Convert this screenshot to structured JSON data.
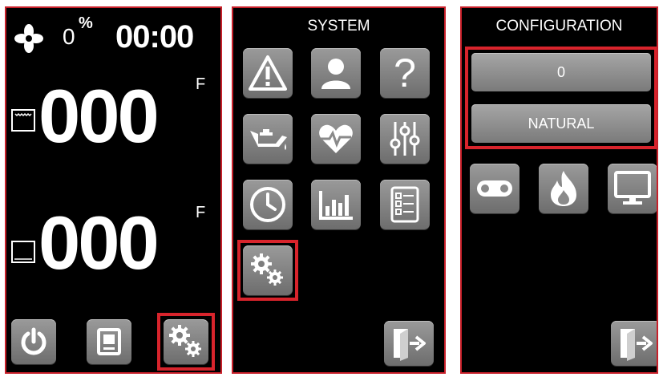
{
  "home": {
    "humidity_value": "0",
    "humidity_unit": "%",
    "timer": "00:00",
    "top_temp": "000",
    "top_unit": "F",
    "bottom_temp": "000",
    "bottom_unit": "F"
  },
  "system": {
    "title": "SYSTEM",
    "icons": [
      "warning-icon",
      "user-icon",
      "help-icon",
      "oil-icon",
      "health-icon",
      "sliders-icon",
      "clock-icon",
      "chart-icon",
      "checklist-icon",
      "gears-icon"
    ]
  },
  "configuration": {
    "title": "CONFIGURATION",
    "value_field": "0",
    "mode_field": "NATURAL"
  },
  "colors": {
    "highlight": "#d8242c",
    "panel_border": "#c8202a",
    "button": "#8a8a8a"
  }
}
